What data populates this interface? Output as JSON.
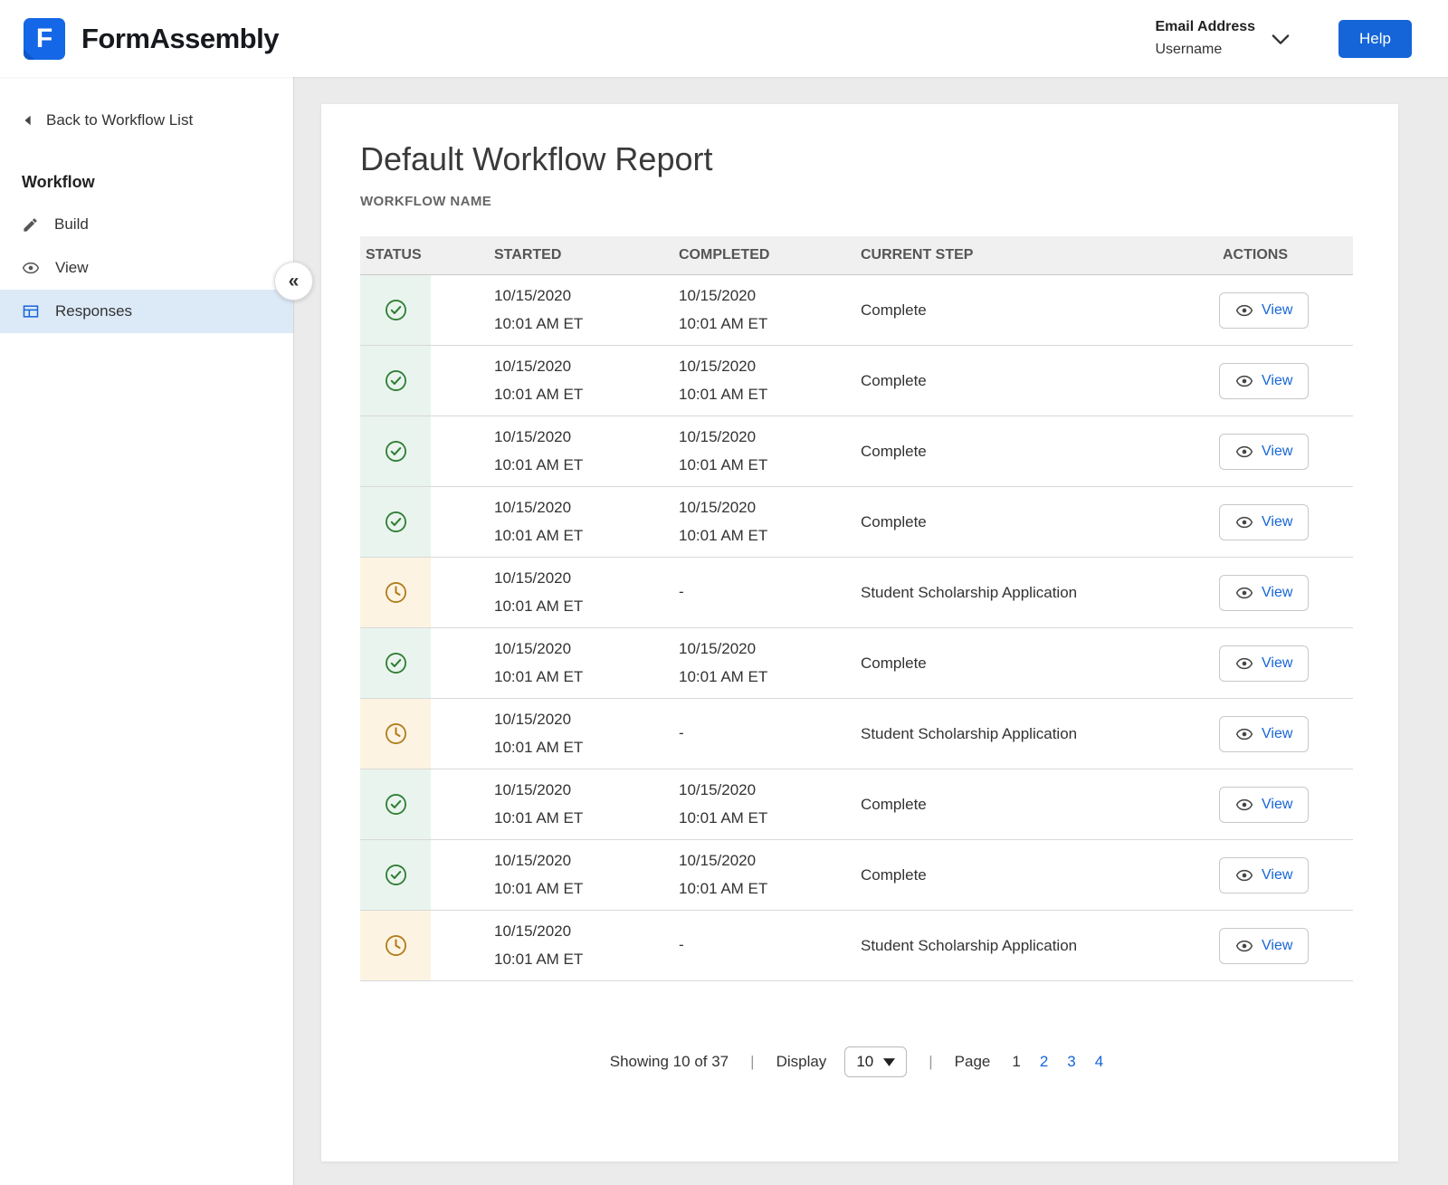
{
  "header": {
    "logo_letter": "F",
    "brand": "FormAssembly",
    "account": {
      "email_label": "Email Address",
      "username": "Username"
    },
    "help_label": "Help"
  },
  "sidebar": {
    "back_label": "Back to Workflow List",
    "section_title": "Workflow",
    "collapse_glyph": "«",
    "items": [
      {
        "label": "Build",
        "icon": "pencil-icon",
        "active": false
      },
      {
        "label": "View",
        "icon": "eye-icon",
        "active": false
      },
      {
        "label": "Responses",
        "icon": "table-icon",
        "active": true
      }
    ]
  },
  "main": {
    "title": "Default Workflow Report",
    "subtitle": "WORKFLOW NAME",
    "table": {
      "headers": [
        "STATUS",
        "STARTED",
        "COMPLETED",
        "CURRENT STEP",
        "ACTIONS"
      ],
      "rows": [
        {
          "status": "complete",
          "status_icon": "check-circle-icon",
          "started_date": "10/15/2020",
          "started_time": "10:01 AM ET",
          "completed_date": "10/15/2020",
          "completed_time": "10:01 AM ET",
          "current_step": "Complete",
          "action_label": "View",
          "action_icon": "eye-icon"
        },
        {
          "status": "complete",
          "status_icon": "check-circle-icon",
          "started_date": "10/15/2020",
          "started_time": "10:01 AM ET",
          "completed_date": "10/15/2020",
          "completed_time": "10:01 AM ET",
          "current_step": "Complete",
          "action_label": "View",
          "action_icon": "eye-icon"
        },
        {
          "status": "complete",
          "status_icon": "check-circle-icon",
          "started_date": "10/15/2020",
          "started_time": "10:01 AM ET",
          "completed_date": "10/15/2020",
          "completed_time": "10:01 AM ET",
          "current_step": "Complete",
          "action_label": "View",
          "action_icon": "eye-icon"
        },
        {
          "status": "complete",
          "status_icon": "check-circle-icon",
          "started_date": "10/15/2020",
          "started_time": "10:01 AM ET",
          "completed_date": "10/15/2020",
          "completed_time": "10:01 AM ET",
          "current_step": "Complete",
          "action_label": "View",
          "action_icon": "eye-icon"
        },
        {
          "status": "pending",
          "status_icon": "clock-icon",
          "started_date": "10/15/2020",
          "started_time": "10:01 AM ET",
          "completed_date": "-",
          "completed_time": "",
          "current_step": "Student Scholarship Application",
          "action_label": "View",
          "action_icon": "eye-icon"
        },
        {
          "status": "complete",
          "status_icon": "check-circle-icon",
          "started_date": "10/15/2020",
          "started_time": "10:01 AM ET",
          "completed_date": "10/15/2020",
          "completed_time": "10:01 AM ET",
          "current_step": "Complete",
          "action_label": "View",
          "action_icon": "eye-icon"
        },
        {
          "status": "pending",
          "status_icon": "clock-icon",
          "started_date": "10/15/2020",
          "started_time": "10:01 AM ET",
          "completed_date": "-",
          "completed_time": "",
          "current_step": "Student Scholarship Application",
          "action_label": "View",
          "action_icon": "eye-icon"
        },
        {
          "status": "complete",
          "status_icon": "check-circle-icon",
          "started_date": "10/15/2020",
          "started_time": "10:01 AM ET",
          "completed_date": "10/15/2020",
          "completed_time": "10:01 AM ET",
          "current_step": "Complete",
          "action_label": "View",
          "action_icon": "eye-icon"
        },
        {
          "status": "complete",
          "status_icon": "check-circle-icon",
          "started_date": "10/15/2020",
          "started_time": "10:01 AM ET",
          "completed_date": "10/15/2020",
          "completed_time": "10:01 AM ET",
          "current_step": "Complete",
          "action_label": "View",
          "action_icon": "eye-icon"
        },
        {
          "status": "pending",
          "status_icon": "clock-icon",
          "started_date": "10/15/2020",
          "started_time": "10:01 AM ET",
          "completed_date": "-",
          "completed_time": "",
          "current_step": "Student Scholarship Application",
          "action_label": "View",
          "action_icon": "eye-icon"
        }
      ]
    },
    "pagination": {
      "showing": "Showing 10 of 37",
      "separator": "|",
      "display_label": "Display",
      "display_value": "10",
      "page_label": "Page",
      "pages": [
        {
          "label": "1",
          "current": true
        },
        {
          "label": "2",
          "current": false
        },
        {
          "label": "3",
          "current": false
        },
        {
          "label": "4",
          "current": false
        }
      ]
    }
  },
  "colors": {
    "accent_blue": "#1565d8",
    "success_green": "#2e7d32",
    "success_bg": "#e9f4ee",
    "pending_amber": "#b07c1c",
    "pending_bg": "#fdf3e2",
    "active_item_bg": "#dce9f7"
  }
}
